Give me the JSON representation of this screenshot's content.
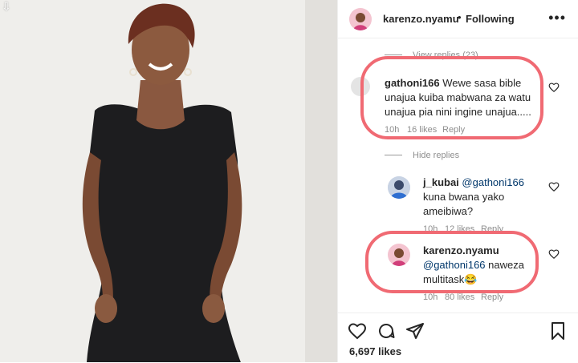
{
  "post": {
    "username": "karenzo.nyamu",
    "dot": "•",
    "follow_status": "Following",
    "likes": "6,697 likes"
  },
  "comments": {
    "view_replies": "View replies (23)",
    "hide_replies": "Hide replies",
    "c1": {
      "user": "gathoni166",
      "text": "Wewe sasa bible unajua kuiba mabwana za watu unajua pia nini ingine unajua.....",
      "time": "10h",
      "likes": "16 likes",
      "reply": "Reply"
    },
    "c2": {
      "user": "j_kubai",
      "mention": "@gathoni166",
      "text": "kuna bwana yako ameibiwa?",
      "time": "10h",
      "likes": "12 likes",
      "reply": "Reply"
    },
    "c3": {
      "user": "karenzo.nyamu",
      "mention": "@gathoni166",
      "text": "naweza multitask",
      "emoji": "😂",
      "time": "10h",
      "likes": "80 likes",
      "reply": "Reply"
    }
  },
  "icons": {
    "heart": "heart-icon",
    "comment": "comment-icon",
    "share": "share-icon",
    "save": "bookmark-icon",
    "more": "more-icon",
    "download": "download-icon"
  },
  "colors": {
    "annotation_circle": "#f06a73",
    "mention": "#00376b",
    "muted": "#8e8e8e"
  }
}
